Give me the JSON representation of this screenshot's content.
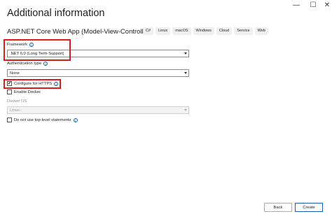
{
  "window": {
    "minimize_glyph": "—",
    "restore_glyph": "☐",
    "close_glyph": "✕"
  },
  "header": {
    "title": "Additional information"
  },
  "project": {
    "name": "ASP.NET Core Web App (Model-View-Controller)",
    "tags": [
      "C#",
      "Linux",
      "macOS",
      "Windows",
      "Cloud",
      "Service",
      "Web"
    ]
  },
  "framework": {
    "label": "Framework",
    "value": ".NET 6.0 (Long Term Support)"
  },
  "authentication": {
    "label": "Authentication type",
    "value": "None"
  },
  "https": {
    "label": "Configure for HTTPS",
    "checked": true,
    "check_glyph": "✔"
  },
  "docker": {
    "label": "Enable Docker",
    "checked": false
  },
  "docker_os": {
    "label": "Docker OS",
    "value": "Linux"
  },
  "top_level": {
    "label": "Do not use top-level statements",
    "checked": false
  },
  "info_glyph": "i",
  "footer": {
    "back_label": "Back",
    "create_label": "Create"
  },
  "colors": {
    "highlight": "#d42020",
    "accent": "#1a5fb4"
  }
}
